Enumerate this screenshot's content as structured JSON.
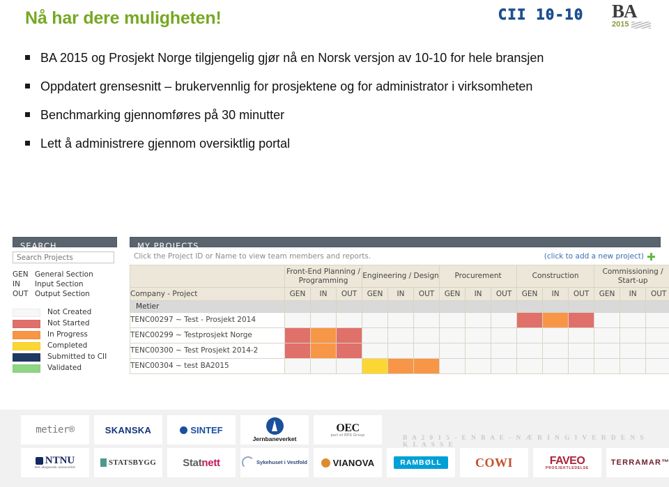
{
  "slide": {
    "title": "Nå har dere muligheten!",
    "bullets": [
      "BA 2015 og Prosjekt Norge tilgjengelig gjør nå en Norsk versjon av 10-10  for hele bransjen",
      "Oppdatert grensesnitt – brukervennlig for prosjektene og for administrator i virksomheten",
      "Benchmarking gjennomføres på 30 minutter",
      "Lett å administrere gjennom oversiktlig portal"
    ]
  },
  "header_logos": {
    "cii": "CII 10-10",
    "ba_name": "BA",
    "ba_year": "2015"
  },
  "app": {
    "search_panel": {
      "header": "SEARCH",
      "search_placeholder": "Search Projects",
      "abbreviations": [
        {
          "key": "GEN",
          "label": "General Section"
        },
        {
          "key": "IN",
          "label": "Input Section"
        },
        {
          "key": "OUT",
          "label": "Output Section"
        }
      ],
      "legend": [
        {
          "label": "Not Created",
          "color": "#f7f7f7"
        },
        {
          "label": "Not Started",
          "color": "#e0706a"
        },
        {
          "label": "In Progress",
          "color": "#f79646"
        },
        {
          "label": "Completed",
          "color": "#fcd734"
        },
        {
          "label": "Submitted to CII",
          "color": "#1f3864"
        },
        {
          "label": "Validated",
          "color": "#8ed683"
        }
      ]
    },
    "projects_panel": {
      "header": "MY PROJECTS",
      "hint": "Click the Project ID or Name to view team members and reports.",
      "add_link": "(click to add a new project)",
      "company_column_header": "Company - Project",
      "phases": [
        "Front-End Planning / Programming",
        "Engineering / Design",
        "Procurement",
        "Construction",
        "Commissioning / Start-up"
      ],
      "sub_columns": [
        "GEN",
        "IN",
        "OUT"
      ],
      "group_row": "Metier",
      "rows": [
        {
          "name": "TENC00297 ~ Test - Prosjekt 2014",
          "cells": [
            "nc",
            "nc",
            "nc",
            "nc",
            "nc",
            "nc",
            "nc",
            "nc",
            "nc",
            "ns",
            "ip",
            "ns",
            "nc",
            "nc",
            "nc"
          ]
        },
        {
          "name": "TENC00299 ~ Testprosjekt Norge",
          "cells": [
            "ns",
            "ip",
            "ns",
            "nc",
            "nc",
            "nc",
            "nc",
            "nc",
            "nc",
            "nc",
            "nc",
            "nc",
            "nc",
            "nc",
            "nc"
          ]
        },
        {
          "name": "TENC00300 ~ Test Prosjekt 2014-2",
          "cells": [
            "ns",
            "ip",
            "ns",
            "nc",
            "nc",
            "nc",
            "nc",
            "nc",
            "nc",
            "nc",
            "nc",
            "nc",
            "nc",
            "nc",
            "nc"
          ]
        },
        {
          "name": "TENC00304 ~ test BA2015",
          "cells": [
            "nc",
            "nc",
            "nc",
            "cp",
            "ip",
            "ip",
            "nc",
            "nc",
            "nc",
            "nc",
            "nc",
            "nc",
            "nc",
            "nc",
            "nc"
          ]
        }
      ]
    }
  },
  "footer": {
    "tagline": "B A 2 0 1 5 -  E N  B A E - N Æ R I N G  I  V E R D E N S K L A S S E",
    "logos_row1": [
      "metier®",
      "SKANSKA",
      "SINTEF",
      "Jernbaneverket",
      "OEC"
    ],
    "logos_row2": [
      "NTNU",
      "STATSBYGG",
      "Statnett",
      "Sykehuset i Vestfold",
      "VIANOVA"
    ],
    "logos_row3": [
      "RAMBØLL",
      "COWI",
      "FAVEO",
      "TERRAMAR"
    ],
    "metier": "metier®",
    "skanska": "SKANSKA",
    "sintef": "SINTEF",
    "jernbaneverket": "Jernbaneverket",
    "oec_main": "OEC",
    "oec_sub": "part of RPS Group",
    "ntnu_main": "NTNU",
    "ntnu_sub": "Det skapende universitet",
    "statsbygg": "STATSBYGG",
    "statnett_a": "Stat",
    "statnett_b": "nett",
    "sykehuset": "Sykehuset i Vestfold",
    "vianova": "VIANOVA",
    "ramboll": "RAMBØLL",
    "cowi": "COWI",
    "faveo_main": "FAVEO",
    "faveo_sub": "PROSJEKTLEDELSE",
    "terramar": "TERRAMAR™"
  },
  "colors": {
    "title_green": "#76a823",
    "panel_header": "#5a646e",
    "table_header": "#ece7d8",
    "link_blue": "#3a6fb5",
    "cii_blue": "#1c4e8f"
  }
}
